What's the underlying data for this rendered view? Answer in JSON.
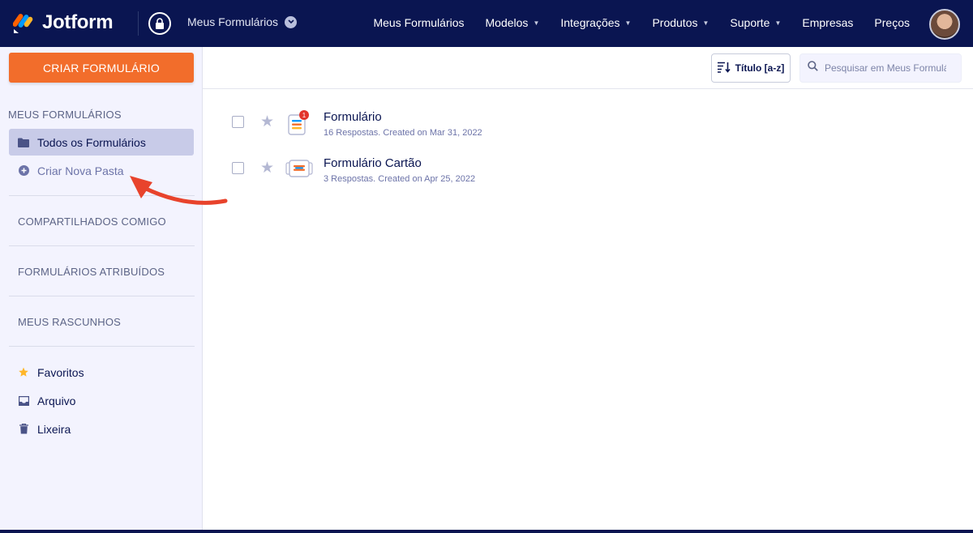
{
  "header": {
    "brand": "Jotform",
    "workspace": "Meus Formulários",
    "nav": [
      {
        "label": "Meus Formulários",
        "dropdown": false
      },
      {
        "label": "Modelos",
        "dropdown": true
      },
      {
        "label": "Integrações",
        "dropdown": true
      },
      {
        "label": "Produtos",
        "dropdown": true
      },
      {
        "label": "Suporte",
        "dropdown": true
      },
      {
        "label": "Empresas",
        "dropdown": false
      },
      {
        "label": "Preços",
        "dropdown": false
      }
    ]
  },
  "sidebar": {
    "create_button": "CRIAR FORMULÁRIO",
    "heading": "MEUS FORMULÁRIOS",
    "all_forms": "Todos os Formulários",
    "new_folder": "Criar Nova Pasta",
    "shared": "COMPARTILHADOS COMIGO",
    "assigned": "FORMULÁRIOS ATRIBUÍDOS",
    "drafts": "MEUS RASCUNHOS",
    "favorites": "Favoritos",
    "archive": "Arquivo",
    "trash": "Lixeira"
  },
  "toolbar": {
    "sort_label": "Título [a-z]",
    "search_placeholder": "Pesquisar em Meus Formulários"
  },
  "forms": [
    {
      "title": "Formulário",
      "meta": "16 Respostas. Created on Mar 31, 2022",
      "badge": "1"
    },
    {
      "title": "Formulário Cartão",
      "meta": "3 Respostas. Created on Apr 25, 2022",
      "badge": ""
    }
  ],
  "colors": {
    "navy": "#0a1551",
    "orange": "#f26d2b",
    "sidebar_bg": "#f3f3fe",
    "active_item": "#c8cbe8",
    "annotation_arrow": "#e8432c"
  }
}
